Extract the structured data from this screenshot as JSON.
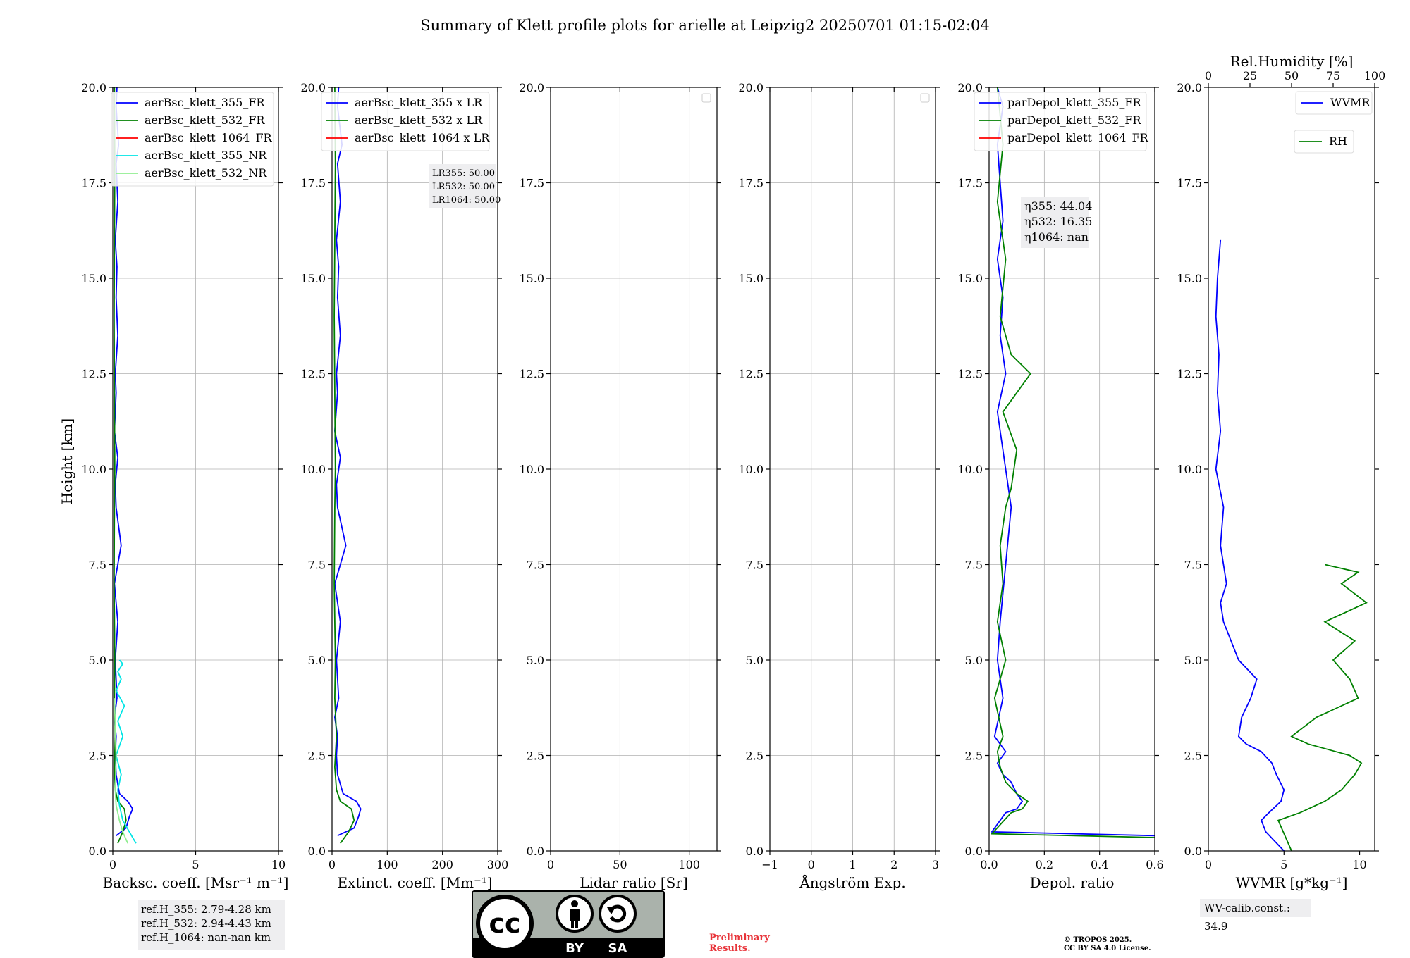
{
  "title": "Summary of Klett profile plots for arielle at Leipzig2 20250701 01:15-02:04",
  "ylabel": "Height [km]",
  "chart_data": [
    {
      "type": "line",
      "panel": "backscatter",
      "xlabel": "Backsc. coeff. [Msr⁻¹ m⁻¹]",
      "xlim": [
        0,
        10
      ],
      "ylim": [
        0,
        20
      ],
      "xticks": [
        "0",
        "5",
        "10"
      ],
      "yticks": [
        "0.0",
        "2.5",
        "5.0",
        "7.5",
        "10.0",
        "12.5",
        "15.0",
        "17.5",
        "20.0"
      ],
      "grid": true,
      "legend": "top-right",
      "series": [
        {
          "name": "aerBsc_klett_355_FR",
          "color": "#0000ff",
          "x": [
            0.2,
            0.8,
            1.0,
            1.2,
            0.9,
            0.4,
            0.2,
            0.15,
            0.2,
            0.1,
            0.25,
            0.15,
            0.3,
            0.1,
            0.5,
            0.2,
            0.15,
            0.3,
            0.1,
            0.2,
            0.15,
            0.3,
            0.2,
            0.25,
            0.15,
            0.3,
            0.2,
            0.35,
            0.2,
            0.25
          ],
          "y": [
            0.4,
            0.6,
            0.9,
            1.1,
            1.3,
            1.5,
            2.0,
            2.5,
            3.0,
            3.5,
            4.0,
            5.0,
            6.0,
            7.0,
            8.0,
            9.0,
            9.6,
            10.3,
            11.0,
            12.0,
            12.5,
            13.5,
            14.5,
            15.3,
            16.0,
            17.0,
            18.0,
            18.5,
            19.5,
            20.0
          ]
        },
        {
          "name": "aerBsc_klett_532_FR",
          "color": "#008000",
          "x": [
            0.3,
            0.6,
            0.8,
            0.7,
            0.3,
            0.15,
            0.1,
            0.15,
            0.1,
            0.12,
            0.08,
            0.1,
            0.12,
            0.1,
            0.08,
            0.1,
            0.12,
            0.1
          ],
          "y": [
            0.2,
            0.5,
            0.8,
            1.1,
            1.3,
            1.6,
            2.2,
            3.0,
            4.0,
            5.0,
            7.0,
            9.0,
            10.0,
            12.0,
            14.0,
            16.0,
            18.0,
            20.0
          ]
        },
        {
          "name": "aerBsc_klett_1064_FR",
          "color": "#ff0000",
          "x": [],
          "y": []
        },
        {
          "name": "aerBsc_klett_355_NR",
          "color": "#00e5e5",
          "x": [
            1.4,
            1.0,
            0.6,
            0.4,
            0.3,
            0.5,
            0.2,
            0.6,
            0.3,
            0.7,
            0.2,
            0.5,
            0.3,
            0.6,
            0.4
          ],
          "y": [
            0.2,
            0.5,
            0.8,
            1.2,
            1.6,
            2.0,
            2.5,
            3.0,
            3.4,
            3.8,
            4.2,
            4.5,
            4.7,
            4.9,
            5.0
          ]
        },
        {
          "name": "aerBsc_klett_532_NR",
          "color": "#90ee90",
          "x": [
            0.9,
            0.6,
            0.4,
            0.2,
            0.15,
            0.2,
            0.1
          ],
          "y": [
            0.2,
            0.5,
            0.8,
            1.2,
            1.6,
            2.5,
            4.0
          ]
        }
      ],
      "annotations": [
        "ref.H_355: 2.79-4.28 km",
        "ref.H_532: 2.94-4.43 km",
        "ref.H_1064: nan-nan km"
      ]
    },
    {
      "type": "line",
      "panel": "extinction",
      "xlabel": "Extinct. coeff. [Mm⁻¹]",
      "xlim": [
        0,
        300
      ],
      "ylim": [
        0,
        20
      ],
      "xticks": [
        "0",
        "100",
        "200",
        "300"
      ],
      "yticks": [
        "0.0",
        "2.5",
        "5.0",
        "7.5",
        "10.0",
        "12.5",
        "15.0",
        "17.5",
        "20.0"
      ],
      "grid": true,
      "legend": "top-right",
      "series": [
        {
          "name": "aerBsc_klett_355 x LR",
          "color": "#0000ff",
          "x": [
            10,
            40,
            48,
            52,
            44,
            20,
            10,
            8,
            10,
            5,
            12,
            8,
            15,
            5,
            25,
            10,
            8,
            15,
            5,
            10,
            8,
            15,
            10,
            12,
            8,
            15,
            10,
            18,
            10,
            12
          ],
          "y": [
            0.4,
            0.6,
            0.9,
            1.1,
            1.3,
            1.5,
            2.0,
            2.5,
            3.0,
            3.5,
            4.0,
            5.0,
            6.0,
            7.0,
            8.0,
            9.0,
            9.6,
            10.3,
            11.0,
            12.0,
            12.5,
            13.5,
            14.5,
            15.3,
            16.0,
            17.0,
            18.0,
            18.5,
            19.5,
            20.0
          ]
        },
        {
          "name": "aerBsc_klett_532 x LR",
          "color": "#008000",
          "x": [
            15,
            30,
            40,
            35,
            15,
            8,
            5,
            8,
            5,
            6,
            4,
            5,
            6,
            5,
            4,
            5,
            6,
            5
          ],
          "y": [
            0.2,
            0.5,
            0.8,
            1.1,
            1.3,
            1.6,
            2.2,
            3.0,
            4.0,
            5.0,
            7.0,
            9.0,
            10.0,
            12.0,
            14.0,
            16.0,
            18.0,
            20.0
          ]
        },
        {
          "name": "aerBsc_klett_1064 x LR",
          "color": "#ff0000",
          "x": [],
          "y": []
        }
      ],
      "annotations": [
        "LR355: 50.00",
        "LR532: 50.00",
        "LR1064: 50.00"
      ]
    },
    {
      "type": "line",
      "panel": "lidar_ratio",
      "xlabel": "Lidar ratio [Sr]",
      "xlim": [
        0,
        120
      ],
      "ylim": [
        0,
        20
      ],
      "xticks": [
        "0",
        "50",
        "100"
      ],
      "yticks": [
        "0.0",
        "2.5",
        "5.0",
        "7.5",
        "10.0",
        "12.5",
        "15.0",
        "17.5",
        "20.0"
      ],
      "grid": true,
      "series": []
    },
    {
      "type": "line",
      "panel": "angstrom",
      "xlabel": "Ångström Exp.",
      "xlim": [
        -1,
        3
      ],
      "ylim": [
        0,
        20
      ],
      "xticks": [
        "−1",
        "0",
        "1",
        "2",
        "3"
      ],
      "yticks": [
        "0.0",
        "2.5",
        "5.0",
        "7.5",
        "10.0",
        "12.5",
        "15.0",
        "17.5",
        "20.0"
      ],
      "grid": true,
      "series": []
    },
    {
      "type": "line",
      "panel": "depol",
      "xlabel": "Depol. ratio",
      "xlim": [
        0,
        0.6
      ],
      "ylim": [
        0,
        20
      ],
      "xticks": [
        "0.0",
        "0.2",
        "0.4",
        "0.6"
      ],
      "yticks": [
        "0.0",
        "2.5",
        "5.0",
        "7.5",
        "10.0",
        "12.5",
        "15.0",
        "17.5",
        "20.0"
      ],
      "grid": true,
      "legend": "top-right",
      "series": [
        {
          "name": "parDepol_klett_355_FR",
          "color": "#0000ff",
          "x": [
            0.6,
            0.01,
            0.06,
            0.1,
            0.12,
            0.1,
            0.08,
            0.05,
            0.03,
            0.06,
            0.02,
            0.05,
            0.03,
            0.04,
            0.06,
            0.08,
            0.05,
            0.03,
            0.06,
            0.04,
            0.05,
            0.03,
            0.05,
            0.04,
            0.03,
            0.05,
            0.03
          ],
          "y": [
            0.4,
            0.5,
            1.0,
            1.1,
            1.3,
            1.5,
            1.8,
            2.0,
            2.3,
            2.6,
            3.0,
            4.0,
            5.0,
            6.0,
            7.5,
            9.0,
            10.5,
            11.5,
            12.5,
            13.5,
            14.5,
            15.5,
            16.5,
            17.5,
            18.5,
            19.5,
            20.0
          ]
        },
        {
          "name": "parDepol_klett_532_FR",
          "color": "#008000",
          "x": [
            0.6,
            0.01,
            0.08,
            0.12,
            0.14,
            0.1,
            0.06,
            0.04,
            0.03,
            0.05,
            0.02,
            0.06,
            0.03,
            0.05,
            0.04,
            0.06,
            0.08,
            0.1,
            0.05,
            0.15,
            0.08,
            0.04,
            0.06,
            0.03,
            0.05,
            0.03
          ],
          "y": [
            0.35,
            0.45,
            1.0,
            1.1,
            1.3,
            1.5,
            1.8,
            2.2,
            2.6,
            3.0,
            4.0,
            5.0,
            6.0,
            7.0,
            8.0,
            9.0,
            9.5,
            10.5,
            11.5,
            12.5,
            13.0,
            14.0,
            15.5,
            17.0,
            18.5,
            20.0
          ]
        },
        {
          "name": "parDepol_klett_1064_FR",
          "color": "#ff0000",
          "x": [],
          "y": []
        }
      ],
      "annotations": [
        "η355: 44.04",
        "η532: 16.35",
        "η1064: nan"
      ]
    },
    {
      "type": "line",
      "panel": "wvmr",
      "xlabel": "WVMR [g*kg⁻¹]",
      "xlim": [
        0,
        11
      ],
      "ylim": [
        0,
        20
      ],
      "xticks": [
        "0",
        "5",
        "10"
      ],
      "x2label": "Rel.Humidity [%]",
      "x2lim": [
        0,
        100
      ],
      "x2ticks": [
        "0",
        "25",
        "50",
        "75",
        "100"
      ],
      "yticks": [
        "0.0",
        "2.5",
        "5.0",
        "7.5",
        "10.0",
        "12.5",
        "15.0",
        "17.5",
        "20.0"
      ],
      "grid": false,
      "series": [
        {
          "name": "WVMR",
          "color": "#0000ff",
          "axis": "x",
          "x": [
            5.0,
            3.8,
            3.5,
            4.0,
            4.8,
            5.0,
            4.5,
            4.2,
            3.5,
            2.5,
            2.0,
            2.2,
            2.8,
            3.2,
            2.0,
            1.5,
            1.0,
            0.8,
            1.2,
            0.8,
            1.0,
            0.5,
            0.8,
            0.6,
            0.7,
            0.5,
            0.6,
            0.8
          ],
          "y": [
            0.0,
            0.5,
            0.8,
            1.0,
            1.3,
            1.6,
            2.0,
            2.3,
            2.6,
            2.8,
            3.0,
            3.5,
            4.0,
            4.5,
            5.0,
            5.5,
            6.0,
            6.5,
            7.0,
            8.0,
            9.0,
            10.0,
            11.0,
            12.0,
            13.0,
            14.0,
            15.0,
            16.0
          ]
        },
        {
          "name": "RH",
          "color": "#008000",
          "axis": "x2",
          "x": [
            50,
            45,
            42,
            55,
            70,
            80,
            88,
            92,
            85,
            60,
            50,
            65,
            90,
            85,
            75,
            88,
            70,
            95,
            80,
            90,
            70
          ],
          "y": [
            0.0,
            0.5,
            0.8,
            1.0,
            1.3,
            1.6,
            2.0,
            2.3,
            2.5,
            2.8,
            3.0,
            3.5,
            4.0,
            4.5,
            5.0,
            5.5,
            6.0,
            6.5,
            7.0,
            7.3,
            7.5
          ]
        }
      ],
      "annotations": [
        "WV-calib.const.: 34.9"
      ]
    }
  ],
  "logo": {
    "letters": "cc",
    "by": "BY",
    "sa": "SA"
  },
  "preliminary": [
    "Preliminary",
    "Results."
  ],
  "copyright": [
    "© TROPOS 2025.",
    "CC BY SA 4.0 License."
  ]
}
